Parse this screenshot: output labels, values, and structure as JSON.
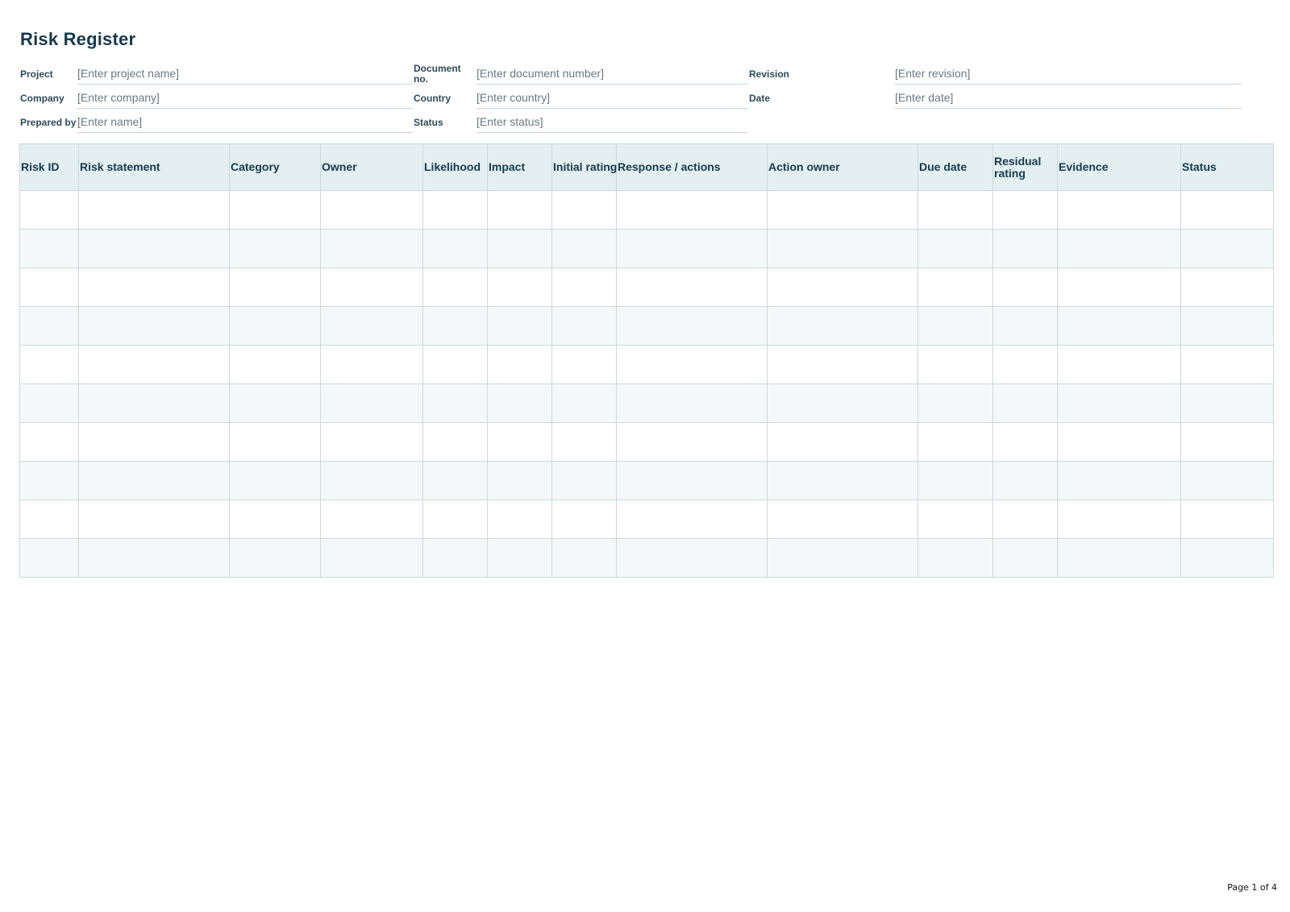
{
  "title": "Risk Register",
  "meta": {
    "project": {
      "label": "Project",
      "placeholder": "[Enter project name]"
    },
    "document_no": {
      "label": "Document no.",
      "placeholder": "[Enter document number]"
    },
    "revision": {
      "label": "Revision",
      "placeholder": "[Enter revision]"
    },
    "company": {
      "label": "Company",
      "placeholder": "[Enter company]"
    },
    "country": {
      "label": "Country",
      "placeholder": "[Enter country]"
    },
    "date": {
      "label": "Date",
      "placeholder": "[Enter date]"
    },
    "prepared_by": {
      "label": "Prepared by",
      "placeholder": "[Enter name]"
    },
    "status": {
      "label": "Status",
      "placeholder": "[Enter status]"
    }
  },
  "table": {
    "columns": [
      "Risk ID",
      "Risk statement",
      "Category",
      "Owner",
      "Likelihood",
      "Impact",
      "Initial rating",
      "Response / actions",
      "Action owner",
      "Due date",
      "Residual rating",
      "Evidence",
      "Status"
    ],
    "rows": [
      [
        "",
        "",
        "",
        "",
        "",
        "",
        "",
        "",
        "",
        "",
        "",
        "",
        ""
      ],
      [
        "",
        "",
        "",
        "",
        "",
        "",
        "",
        "",
        "",
        "",
        "",
        "",
        ""
      ],
      [
        "",
        "",
        "",
        "",
        "",
        "",
        "",
        "",
        "",
        "",
        "",
        "",
        ""
      ],
      [
        "",
        "",
        "",
        "",
        "",
        "",
        "",
        "",
        "",
        "",
        "",
        "",
        ""
      ],
      [
        "",
        "",
        "",
        "",
        "",
        "",
        "",
        "",
        "",
        "",
        "",
        "",
        ""
      ],
      [
        "",
        "",
        "",
        "",
        "",
        "",
        "",
        "",
        "",
        "",
        "",
        "",
        ""
      ],
      [
        "",
        "",
        "",
        "",
        "",
        "",
        "",
        "",
        "",
        "",
        "",
        "",
        ""
      ],
      [
        "",
        "",
        "",
        "",
        "",
        "",
        "",
        "",
        "",
        "",
        "",
        "",
        ""
      ],
      [
        "",
        "",
        "",
        "",
        "",
        "",
        "",
        "",
        "",
        "",
        "",
        "",
        ""
      ],
      [
        "",
        "",
        "",
        "",
        "",
        "",
        "",
        "",
        "",
        "",
        "",
        "",
        ""
      ]
    ]
  },
  "footer": {
    "page": "Page 1 of 4"
  }
}
